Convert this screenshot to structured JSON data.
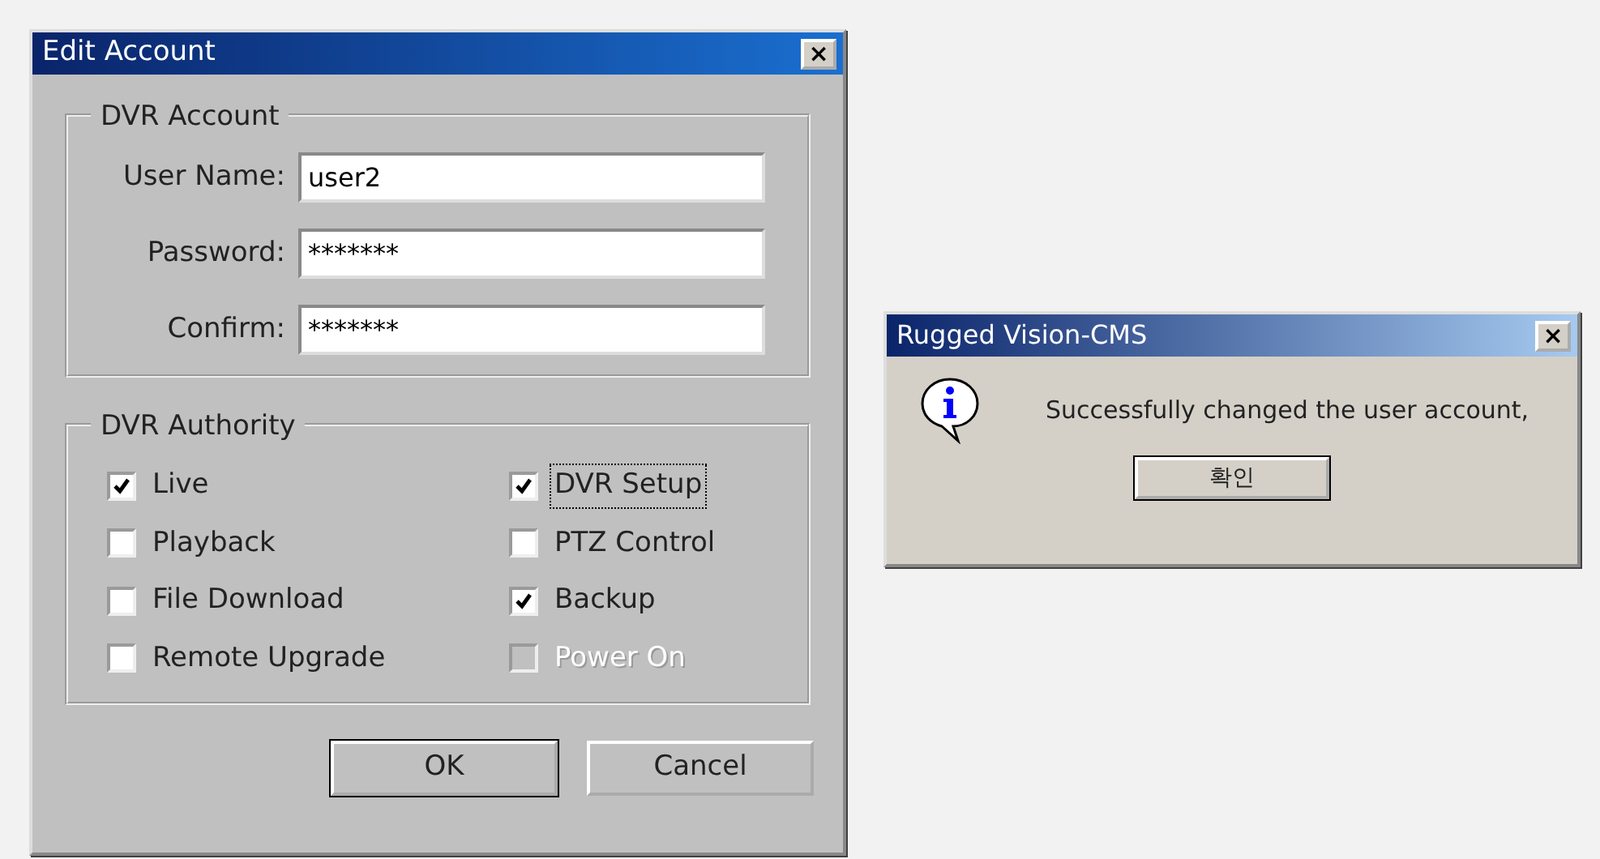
{
  "edit_account": {
    "title": "Edit Account",
    "close": "×",
    "account": {
      "legend": "DVR Account",
      "fields": [
        {
          "label": "User Name:",
          "value": "user2"
        },
        {
          "label": "Password:",
          "value": "*******"
        },
        {
          "label": "Confirm:",
          "value": "*******"
        }
      ]
    },
    "authority": {
      "legend": "DVR Authority",
      "columns": [
        [
          {
            "label": "Live",
            "checked": true,
            "disabled": false,
            "focused": false
          },
          {
            "label": "Playback",
            "checked": false,
            "disabled": false,
            "focused": false
          },
          {
            "label": "File Download",
            "checked": false,
            "disabled": false,
            "focused": false
          },
          {
            "label": "Remote Upgrade",
            "checked": false,
            "disabled": false,
            "focused": false
          }
        ],
        [
          {
            "label": "DVR Setup",
            "checked": true,
            "disabled": false,
            "focused": true
          },
          {
            "label": "PTZ Control",
            "checked": false,
            "disabled": false,
            "focused": false
          },
          {
            "label": "Backup",
            "checked": true,
            "disabled": false,
            "focused": false
          },
          {
            "label": "Power On",
            "checked": false,
            "disabled": true,
            "focused": false
          }
        ]
      ]
    },
    "buttons": [
      {
        "label": "OK",
        "default": true
      },
      {
        "label": "Cancel",
        "default": false
      }
    ]
  },
  "message_box": {
    "title": "Rugged Vision-CMS",
    "close": "×",
    "message": "Successfully changed the user account,",
    "button": "확인"
  }
}
